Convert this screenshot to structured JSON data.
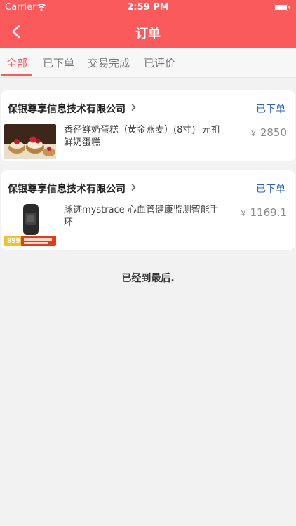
{
  "status_bar": {
    "carrier": "Carrier",
    "time": "2:59 PM"
  },
  "nav": {
    "title": "订单"
  },
  "tabs": [
    {
      "label": "全部",
      "active": true
    },
    {
      "label": "已下单",
      "active": false
    },
    {
      "label": "交易完成",
      "active": false
    },
    {
      "label": "已评价",
      "active": false
    }
  ],
  "orders": [
    {
      "shop_name": "保银尊享信息技术有限公司",
      "status": "已下单",
      "product_name": "香径鲜奶蛋糕（黄金燕麦）(8寸)--元祖鲜奶蛋糕",
      "currency": "¥",
      "price": "2850"
    },
    {
      "shop_name": "保银尊享信息技术有限公司",
      "status": "已下单",
      "product_name": "脉迹mystrace 心血管健康监测智能手环",
      "currency": "¥",
      "price": "1169.1",
      "thumb_badge": "899"
    }
  ],
  "footer": {
    "end_text": "已经到最后."
  },
  "colors": {
    "accent": "#fb5a5c",
    "status": "#2b63b8"
  }
}
